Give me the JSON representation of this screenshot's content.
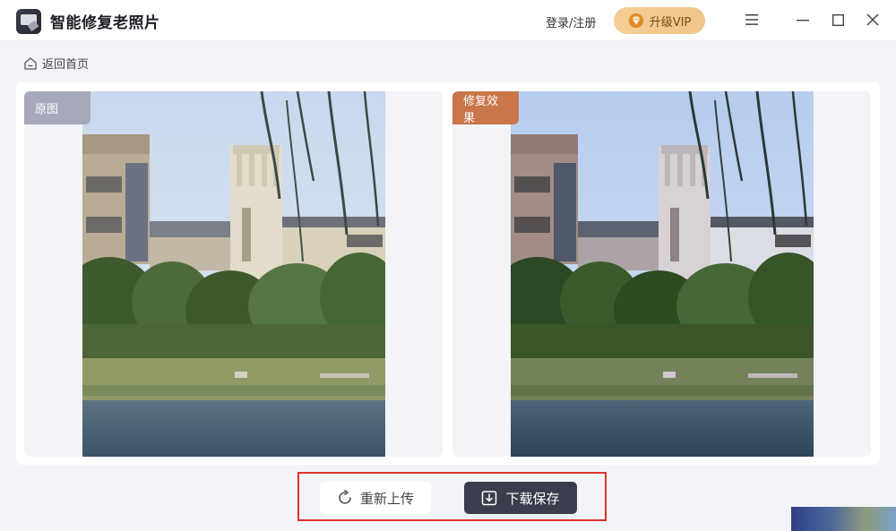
{
  "app": {
    "title": "智能修复老照片"
  },
  "header": {
    "login_label": "登录/注册",
    "vip_label": "升级VIP",
    "icons": [
      "menu-icon",
      "minimize-icon",
      "maximize-icon",
      "close-icon"
    ]
  },
  "nav": {
    "back_label": "返回首页"
  },
  "compare": {
    "original_tag": "原图",
    "restored_tag": "修复效果"
  },
  "actions": {
    "reupload_label": "重新上传",
    "download_label": "下载保存"
  },
  "colors": {
    "vip_gold": "#f0c58c",
    "original_tag": "#a5a9ba",
    "restored_tag": "#c9764b",
    "download_button": "#3b3d4d",
    "highlight_border": "#e0312b"
  }
}
